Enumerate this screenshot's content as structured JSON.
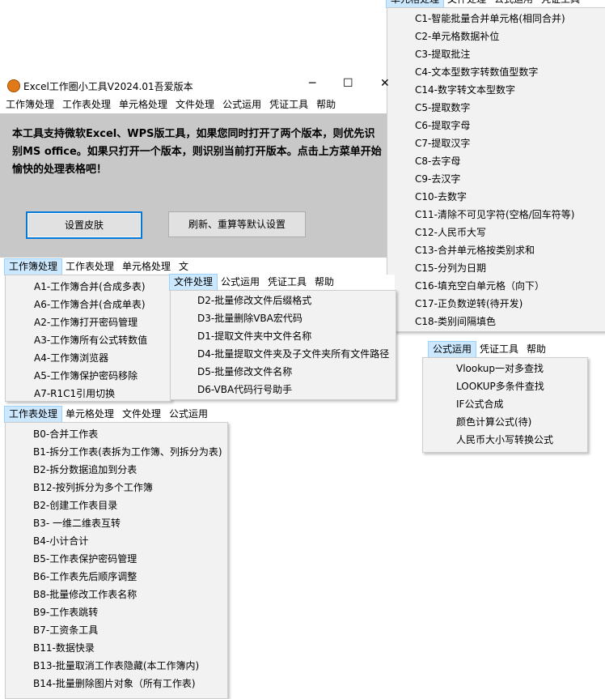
{
  "app": {
    "title": "Excel工作圈小工具V2024.01吾爱版本",
    "minimize": "─",
    "maximize": "☐",
    "close": "✕",
    "message": "本工具支持微软Excel、WPS版工具，如果您同时打开了两个版本，则优先识别MS office。如果只打开一个版本，则识别当前打开版本。点击上方菜单开始愉快的处理表格吧！",
    "btn_skin": "设置皮肤",
    "btn_refresh": "刷新、重算等默认设置"
  },
  "main_menu": [
    "工作簿处理",
    "工作表处理",
    "单元格处理",
    "文件处理",
    "公式运用",
    "凭证工具",
    "帮助"
  ],
  "cell_menu": {
    "bar": [
      "单元格处理",
      "文件处理",
      "公式运用",
      "凭证工具"
    ],
    "items": [
      "C1-智能批量合并单元格(相同合并)",
      "C2-单元格数据补位",
      "C3-提取批注",
      "C4-文本型数字转数值型数字",
      "C14-数字转文本型数字",
      "C5-提取数字",
      "C6-提取字母",
      "C7-提取汉字",
      "C8-去字母",
      "C9-去汉字",
      "C10-去数字",
      "C11-清除不可见字符(空格/回车符等)",
      "C12-人民币大写",
      "C13-合并单元格按类别求和",
      "C15-分列为日期",
      "C16-填充空白单元格（向下）",
      "C17-正负数逆转(待开发)",
      "C18-类别间隔填色"
    ]
  },
  "workbook_menu": {
    "bar": [
      "工作簿处理",
      "工作表处理",
      "单元格处理",
      "文"
    ],
    "items": [
      "A1-工作簿合并(合成多表)",
      "A6-工作簿合并(合成单表)",
      "A2-工作簿打开密码管理",
      "A3-工作簿所有公式转数值",
      "A4-工作簿浏览器",
      "A5-工作簿保护密码移除",
      "A7-R1C1引用切换"
    ]
  },
  "file_menu": {
    "bar": [
      "文件处理",
      "公式运用",
      "凭证工具",
      "帮助"
    ],
    "items": [
      "D2-批量修改文件后缀格式",
      "D3-批量删除VBA宏代码",
      "D1-提取文件夹中文件名称",
      "D4-批量提取文件夹及子文件夹所有文件路径",
      "D5-批量修改文件名称",
      "D6-VBA代码行号助手"
    ]
  },
  "formula_menu": {
    "bar": [
      "公式运用",
      "凭证工具",
      "帮助"
    ],
    "items": [
      "Vlookup一对多查找",
      "LOOKUP多条件查找",
      "IF公式合成",
      "颜色计算公式(待)",
      "人民币大小写转换公式"
    ]
  },
  "sheet_menu": {
    "bar": [
      "工作表处理",
      "单元格处理",
      "文件处理",
      "公式运用"
    ],
    "items": [
      "B0-合并工作表",
      "B1-拆分工作表(表拆为工作簿、列拆分为表)",
      "B2-拆分数据追加到分表",
      "B12-按列拆分为多个工作簿",
      "B2-创建工作表目录",
      "B3- 一维二维表互转",
      "B4-小计合计",
      "B5-工作表保护密码管理",
      "B6-工作表先后顺序调整",
      "B8-批量修改工作表名称",
      "B9-工作表跳转",
      "B7-工资条工具",
      "B11-数据快录",
      "B13-批量取消工作表隐藏(本工作簿内)",
      "B14-批量删除图片对象（所有工作表)"
    ]
  },
  "colors": {
    "active_menu": "#cce8ff",
    "body_gray": "#c8c8c8",
    "dropdown_bg": "#f2f2f2",
    "default_button_border": "#0078d7"
  }
}
